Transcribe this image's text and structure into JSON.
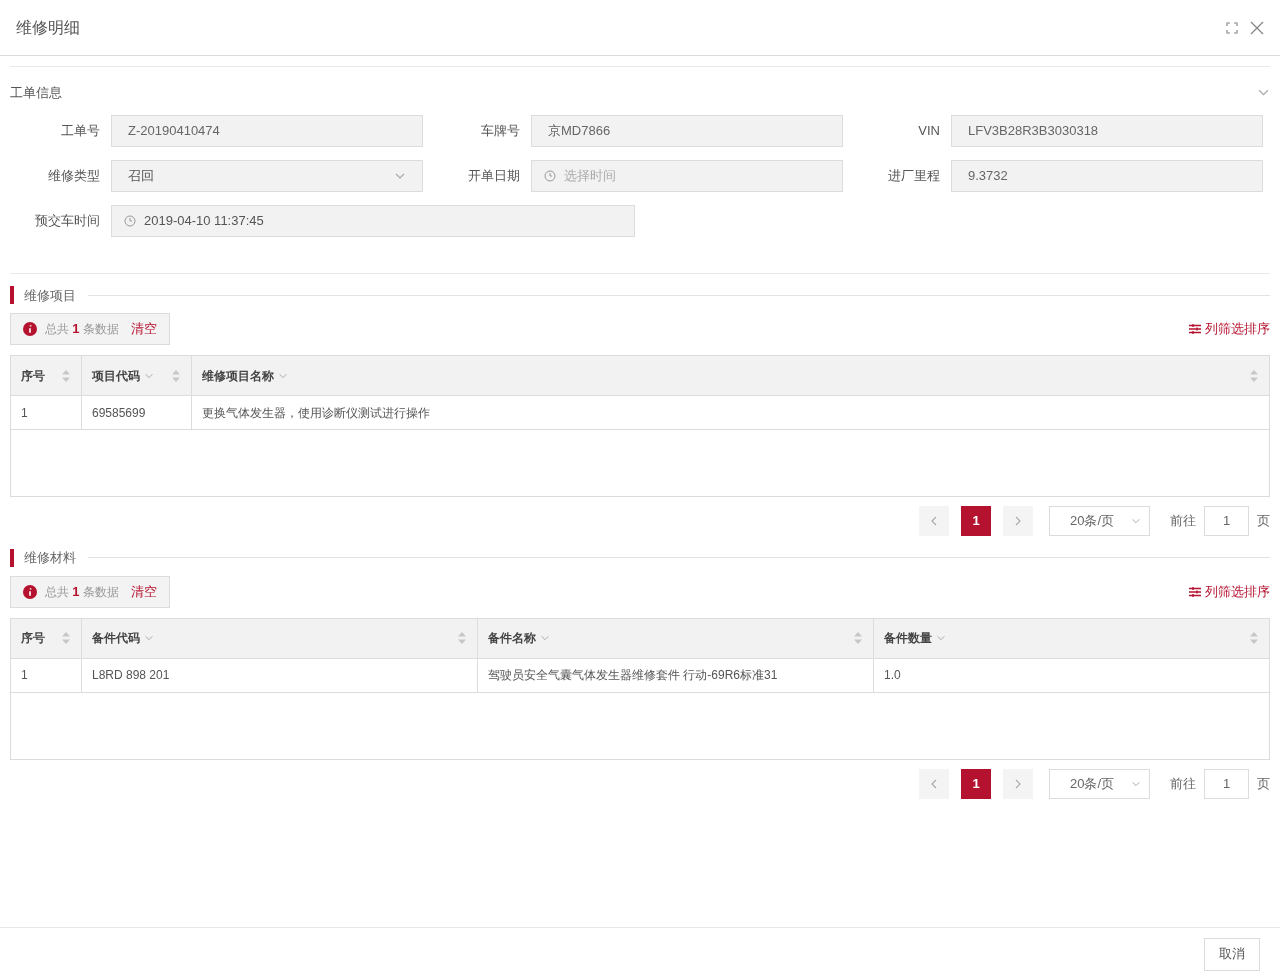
{
  "dialog": {
    "title": "维修明细"
  },
  "work_order": {
    "title": "工单信息",
    "expanded": true,
    "rows": [
      [
        {
          "label": "工单号",
          "kind": "text",
          "value": "Z-20190410474"
        },
        {
          "label": "车牌号",
          "kind": "text",
          "value": "京MD7866"
        },
        {
          "label": "VIN",
          "kind": "text",
          "value": "LFV3B28R3B3030318"
        }
      ],
      [
        {
          "label": "维修类型",
          "kind": "select",
          "value": "召回"
        },
        {
          "label": "开单日期",
          "kind": "date",
          "placeholder": "选择时间"
        },
        {
          "label": "进厂里程",
          "kind": "text",
          "value": "9.3732"
        }
      ],
      [
        {
          "label": "预交车时间",
          "kind": "date",
          "value": "2019-04-10 11:37:45"
        }
      ]
    ]
  },
  "sections": [
    {
      "title": "维修项目",
      "summary": {
        "prefix": "总共",
        "count": "1",
        "suffix": "条数据",
        "clear": "清空"
      },
      "column_settings": "列筛选排序",
      "table": {
        "columns": [
          {
            "label": "序号",
            "filter": false,
            "sortable": true
          },
          {
            "label": "项目代码",
            "filter": true,
            "sortable": true
          },
          {
            "label": "维修项目名称",
            "filter": true,
            "sortable": true
          }
        ],
        "rows": [
          [
            "1",
            "69585699",
            "更换气体发生器，使用诊断仪测试进行操作"
          ]
        ]
      },
      "pagination": {
        "pages": [
          {
            "label": "1",
            "selected": true
          }
        ],
        "page_size": "20条/页",
        "goto_label": "前往",
        "goto_value": "1",
        "page_unit": "页"
      }
    },
    {
      "title": "维修材料",
      "summary": {
        "prefix": "总共",
        "count": "1",
        "suffix": "条数据",
        "clear": "清空"
      },
      "column_settings": "列筛选排序",
      "table": {
        "columns": [
          {
            "label": "序号",
            "filter": false,
            "sortable": true
          },
          {
            "label": "备件代码",
            "filter": true,
            "sortable": true
          },
          {
            "label": "备件名称",
            "filter": true,
            "sortable": true
          },
          {
            "label": "备件数量",
            "filter": true,
            "sortable": true
          }
        ],
        "rows": [
          [
            "1",
            "L8RD 898 201",
            "驾驶员安全气囊气体发生器维修套件 行动-69R6标准31",
            "1.0"
          ]
        ]
      },
      "pagination": {
        "pages": [
          {
            "label": "1",
            "selected": true
          }
        ],
        "page_size": "20条/页",
        "goto_label": "前往",
        "goto_value": "1",
        "page_unit": "页"
      }
    }
  ],
  "footer": {
    "cancel": "取消"
  }
}
